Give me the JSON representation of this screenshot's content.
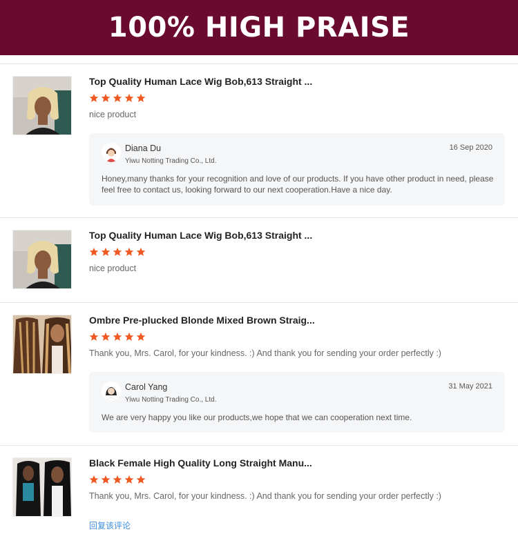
{
  "banner": {
    "title": "100% HIGH PRAISE"
  },
  "colors": {
    "banner": "#6b0a2f",
    "star": "#f05a22",
    "link": "#3c8ee0",
    "reply_bg": "#f5f6f8"
  },
  "reviews": [
    {
      "product_title": "Top Quality Human Lace Wig Bob,613 Straight ...",
      "rating": 5,
      "comment": "nice product",
      "thumb_icon": "blonde-bob-wig-photo",
      "reply": {
        "seller_name": "Diana Du",
        "company": "Yiwu Notting Trading Co., Ltd.",
        "date": "16 Sep 2020",
        "text": "Honey,many thanks for your recognition and love of our products. If you have other product in need, please feel free to contact us, looking forward to our next cooperation.Have a nice day."
      }
    },
    {
      "product_title": "Top Quality Human Lace Wig Bob,613 Straight ...",
      "rating": 5,
      "comment": "nice product",
      "thumb_icon": "blonde-bob-wig-photo"
    },
    {
      "product_title": "Ombre Pre-plucked Blonde Mixed Brown Straig...",
      "rating": 5,
      "comment": "Thank you, Mrs. Carol, for your kindness. :) And thank you for sending your order perfectly :)",
      "thumb_icon": "ombre-straight-wig-photo",
      "reply": {
        "seller_name": "Carol Yang",
        "company": "Yiwu Notting Trading Co., Ltd.",
        "date": "31 May 2021",
        "text": "We are very happy you like our products,we hope that we can cooperation next time."
      }
    },
    {
      "product_title": "Black Female High Quality Long Straight Manu...",
      "rating": 5,
      "comment": "Thank you, Mrs. Carol, for your kindness. :) And thank you for sending your order perfectly :)",
      "thumb_icon": "long-black-straight-wig-photo",
      "reply_link": "回复该评论"
    }
  ]
}
